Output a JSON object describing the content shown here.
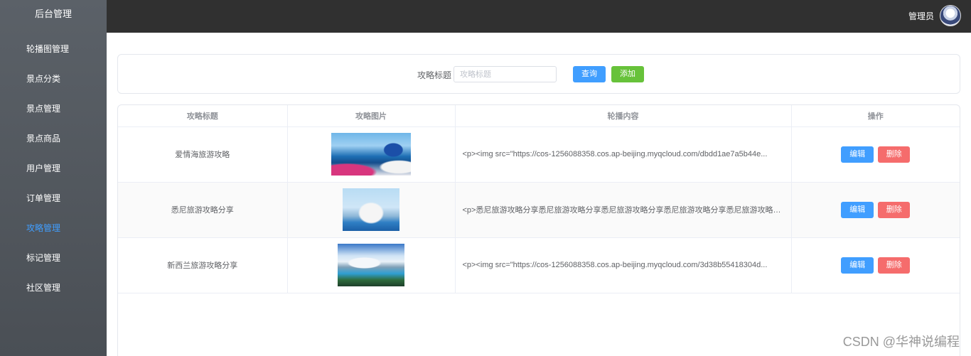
{
  "sidebar": {
    "title": "后台管理",
    "items": [
      {
        "label": "轮播图管理",
        "active": false
      },
      {
        "label": "景点分类",
        "active": false
      },
      {
        "label": "景点管理",
        "active": false
      },
      {
        "label": "景点商品",
        "active": false
      },
      {
        "label": "用户管理",
        "active": false
      },
      {
        "label": "订单管理",
        "active": false
      },
      {
        "label": "攻略管理",
        "active": true
      },
      {
        "label": "标记管理",
        "active": false
      },
      {
        "label": "社区管理",
        "active": false
      }
    ],
    "active_color": "#409eff"
  },
  "topbar": {
    "user_name": "管理员",
    "avatar_icon": "avatar-icon"
  },
  "search": {
    "label": "攻略标题",
    "placeholder": "攻略标题",
    "value": "",
    "query_label": "查询",
    "add_label": "添加"
  },
  "table": {
    "columns": [
      "攻略标题",
      "攻略图片",
      "轮播内容",
      "操作"
    ],
    "rows": [
      {
        "title": "爱情海旅游攻略",
        "image": "santorini-photo",
        "content": "<p><img src=\"https://cos-1256088358.cos.ap-beijing.myqcloud.com/dbdd1ae7a5b44e...",
        "edit_label": "编辑",
        "delete_label": "删除"
      },
      {
        "title": "悉尼旅游攻略分享",
        "image": "sydney-opera-house-photo",
        "content": "<p>悉尼旅游攻略分享悉尼旅游攻略分享悉尼旅游攻略分享悉尼旅游攻略分享悉尼旅游攻略分享...",
        "edit_label": "编辑",
        "delete_label": "删除"
      },
      {
        "title": "新西兰旅游攻略分享",
        "image": "new-zealand-lake-photo",
        "content": "<p><img src=\"https://cos-1256088358.cos.ap-beijing.myqcloud.com/3d38b55418304d...",
        "edit_label": "编辑",
        "delete_label": "删除"
      }
    ]
  },
  "watermark": "CSDN @华神说编程",
  "colors": {
    "primary": "#409eff",
    "success": "#67c23a",
    "danger": "#f56c6c",
    "topbar": "#303030"
  }
}
